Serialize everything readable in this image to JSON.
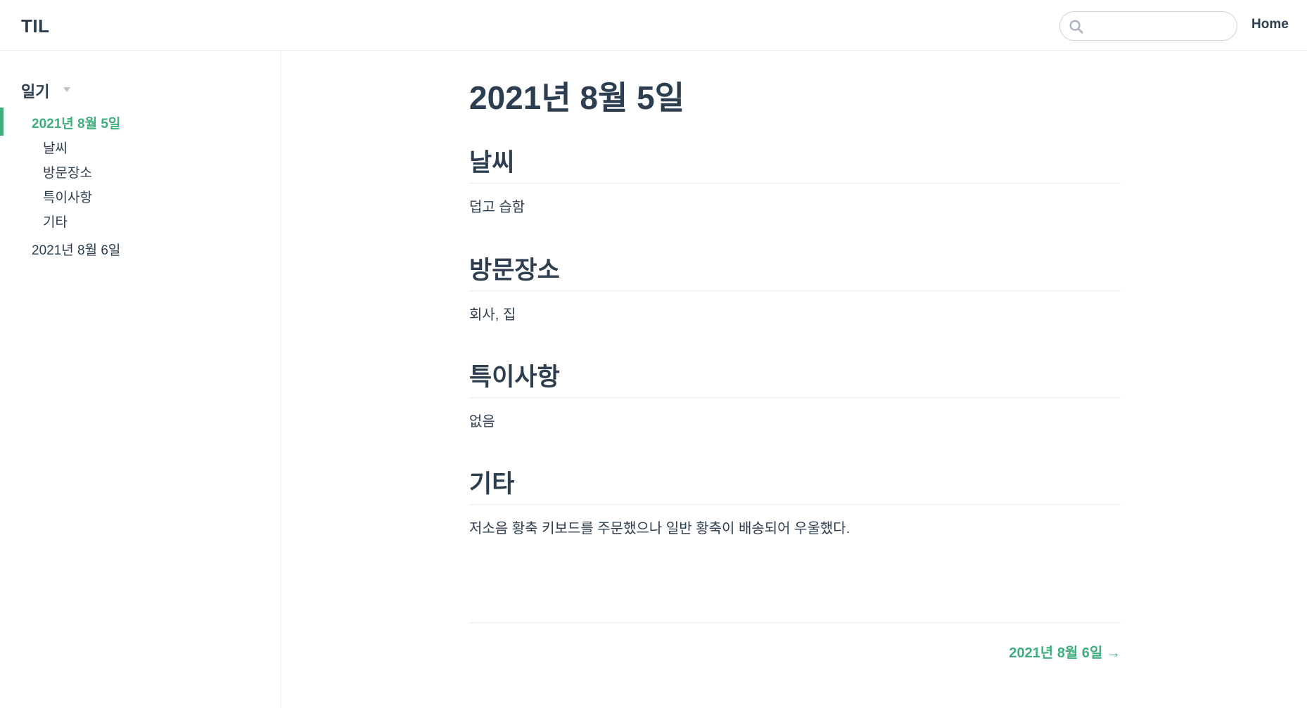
{
  "navbar": {
    "site_name": "TIL",
    "search": {
      "value": "",
      "placeholder": ""
    },
    "home_label": "Home"
  },
  "sidebar": {
    "group_title": "일기",
    "active_item": "2021년 8월 5일",
    "sub_items": [
      "날씨",
      "방문장소",
      "특이사항",
      "기타"
    ],
    "other_item": "2021년 8월 6일"
  },
  "page": {
    "title": "2021년 8월 5일",
    "sections": [
      {
        "heading": "날씨",
        "text": "덥고 습함"
      },
      {
        "heading": "방문장소",
        "text": "회사, 집"
      },
      {
        "heading": "특이사항",
        "text": "없음"
      },
      {
        "heading": "기타",
        "text": "저소음 황축 키보드를 주문했으나 일반 황축이 배송되어 우울했다."
      }
    ],
    "next_link": "2021년 8월 6일 →"
  },
  "colors": {
    "accent": "#3eaf7c",
    "text": "#2c3e50",
    "border": "#eaecef"
  },
  "icons": {
    "search": "search-icon",
    "sidebar_toggle": "caret-down-icon"
  }
}
